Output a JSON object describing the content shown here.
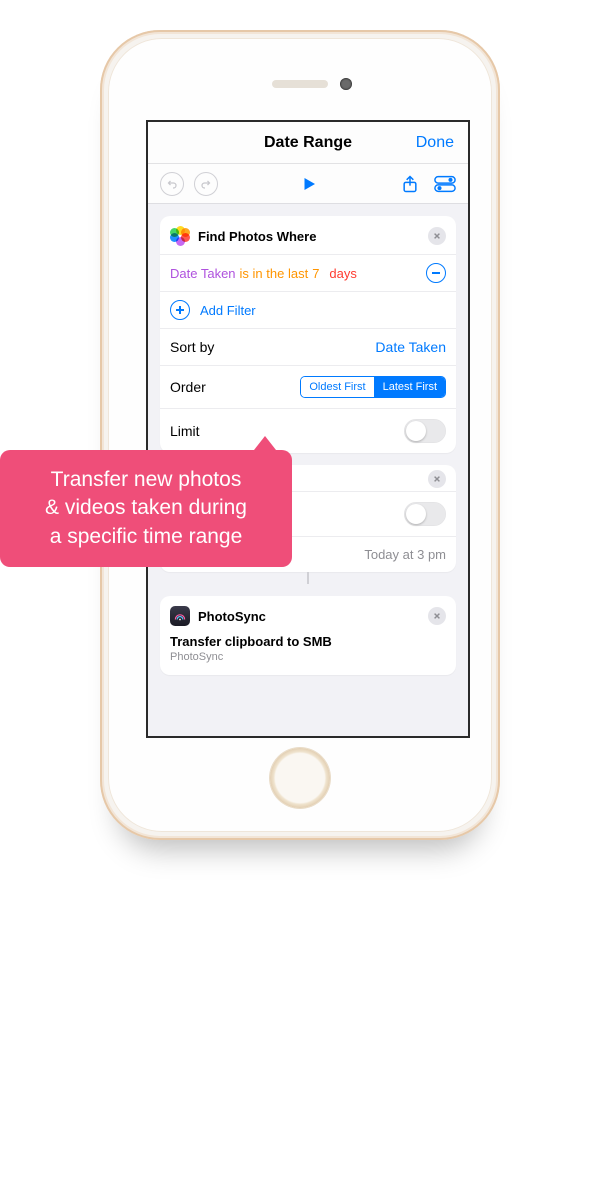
{
  "nav": {
    "title": "Date Range",
    "done": "Done"
  },
  "card_find": {
    "title": "Find Photos Where",
    "filter": {
      "field": "Date Taken",
      "predicate": "is in the last",
      "value": "7",
      "unit": "days"
    },
    "add_filter": "Add Filter",
    "sort_by_label": "Sort by",
    "sort_by_value": "Date Taken",
    "order_label": "Order",
    "order_opts": {
      "a": "Oldest First",
      "b": "Latest First"
    },
    "limit_label": "Limit"
  },
  "card_hidden": {
    "time_value": "Today at 3 pm"
  },
  "card_photosync": {
    "title": "PhotoSync",
    "body": "Transfer clipboard to SMB",
    "sub": "PhotoSync"
  },
  "callout": {
    "line1": "Transfer new photos",
    "line2": "& videos taken during",
    "line3": "a specific time range"
  }
}
